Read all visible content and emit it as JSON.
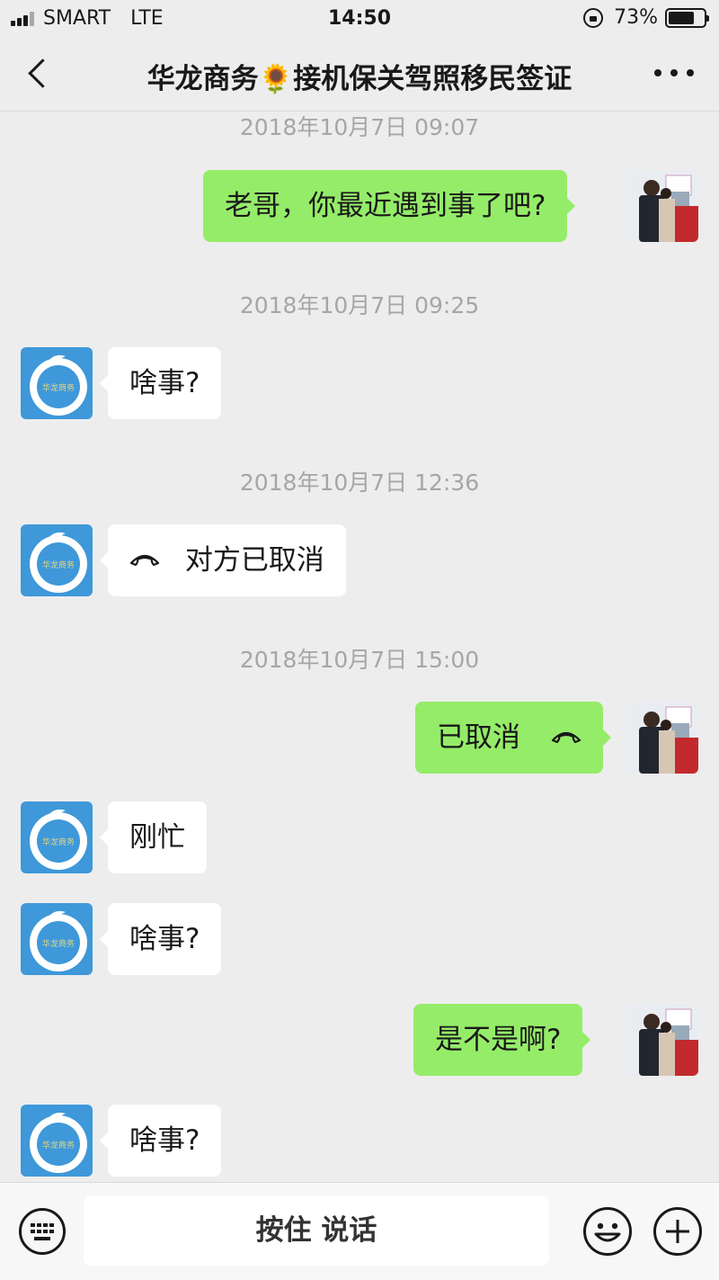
{
  "status_bar": {
    "carrier": "SMART",
    "network": "LTE",
    "time": "14:50",
    "battery": "73%",
    "battery_level": 0.73,
    "signal_bars": 3
  },
  "header": {
    "title": "华龙商务🌻接机保关驾照移民签证"
  },
  "messages": [
    {
      "type": "timestamp",
      "text": "2018年10月7日 09:07"
    },
    {
      "type": "outgoing",
      "text": "老哥，你最近遇到事了吧?"
    },
    {
      "type": "timestamp",
      "text": "2018年10月7日 09:25"
    },
    {
      "type": "incoming",
      "text": "啥事?"
    },
    {
      "type": "timestamp",
      "text": "2018年10月7日 12:36"
    },
    {
      "type": "incoming_call",
      "text": "对方已取消"
    },
    {
      "type": "timestamp",
      "text": "2018年10月7日 15:00"
    },
    {
      "type": "outgoing_call",
      "text": "已取消"
    },
    {
      "type": "incoming",
      "text": "刚忙"
    },
    {
      "type": "incoming",
      "text": "啥事?"
    },
    {
      "type": "outgoing",
      "text": "是不是啊?"
    },
    {
      "type": "incoming",
      "text": "啥事?"
    }
  ],
  "input_bar": {
    "talk_label": "按住 说话",
    "keyboard_icon": "keyboard-icon",
    "emoji_icon": "emoji-icon",
    "plus_icon": "plus-icon"
  },
  "colors": {
    "background": "#ededed",
    "outgoing_bubble": "#95ec69",
    "incoming_bubble": "#ffffff",
    "timestamp": "#a6a6a6"
  }
}
